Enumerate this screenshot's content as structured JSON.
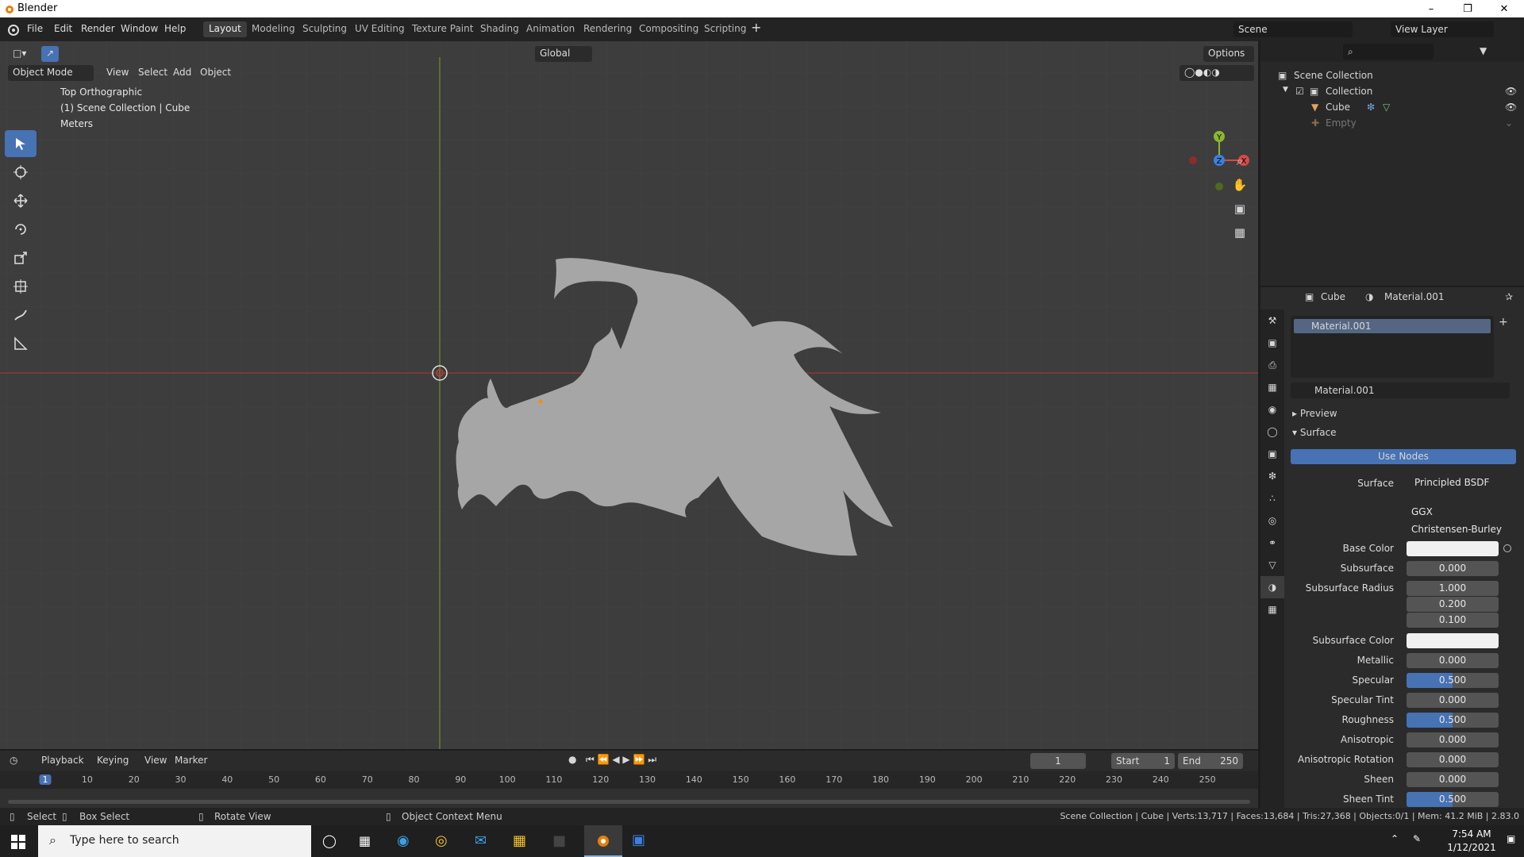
{
  "app": {
    "title": "Blender"
  },
  "menus": [
    "File",
    "Edit",
    "Render",
    "Window",
    "Help"
  ],
  "workspaces": [
    "Layout",
    "Modeling",
    "Sculpting",
    "UV Editing",
    "Texture Paint",
    "Shading",
    "Animation",
    "Rendering",
    "Compositing",
    "Scripting"
  ],
  "active_workspace": "Layout",
  "scene": {
    "name": "Scene",
    "view_layer": "View Layer"
  },
  "viewport": {
    "orientation": "Global",
    "options": "Options",
    "mode": "Object Mode",
    "header_menus": [
      "View",
      "Select",
      "Add",
      "Object"
    ],
    "overlay_lines": [
      "Top Orthographic",
      "(1) Scene Collection | Cube",
      "Meters"
    ],
    "gizmo": {
      "y": "Y",
      "x": "X",
      "z": "Z"
    }
  },
  "outliner": {
    "root": "Scene Collection",
    "collection": "Collection",
    "objects": [
      "Cube",
      "Empty"
    ]
  },
  "properties": {
    "object": "Cube",
    "material": "Material.001",
    "slot": "Material.001",
    "panels": {
      "preview": "Preview",
      "surface": "Surface"
    },
    "use_nodes": "Use Nodes",
    "surface_label": "Surface",
    "surface_value": "Principled BSDF",
    "distribution": "GGX",
    "subsurface_method": "Christensen-Burley",
    "base_color_label": "Base Color",
    "base_color": "#f0f0f0",
    "subsurface_color_label": "Subsurface Color",
    "subsurface_color": "#f0f0f0",
    "subsurface_radius_label": "Subsurface Radius",
    "subsurface_radius": [
      "1.000",
      "0.200",
      "0.100"
    ],
    "fields": [
      {
        "label": "Subsurface",
        "value": "0.000"
      },
      {
        "label": "Metallic",
        "value": "0.000"
      },
      {
        "label": "Specular",
        "value": "0.500"
      },
      {
        "label": "Specular Tint",
        "value": "0.000"
      },
      {
        "label": "Roughness",
        "value": "0.500"
      },
      {
        "label": "Anisotropic",
        "value": "0.000"
      },
      {
        "label": "Anisotropic Rotation",
        "value": "0.000"
      },
      {
        "label": "Sheen",
        "value": "0.000"
      },
      {
        "label": "Sheen Tint",
        "value": "0.500"
      }
    ]
  },
  "timeline": {
    "menus": [
      "Playback",
      "Keying",
      "View",
      "Marker"
    ],
    "current_frame": "1",
    "start_label": "Start",
    "start": "1",
    "end_label": "End",
    "end": "250",
    "ruler": [
      "1",
      "10",
      "20",
      "30",
      "40",
      "50",
      "60",
      "70",
      "80",
      "90",
      "100",
      "110",
      "120",
      "130",
      "140",
      "150",
      "160",
      "170",
      "180",
      "190",
      "200",
      "210",
      "220",
      "230",
      "240",
      "250"
    ]
  },
  "status": {
    "select": "Select",
    "box_select": "Box Select",
    "rotate": "Rotate View",
    "context": "Object Context Menu",
    "stats": "Scene Collection | Cube | Verts:13,717 | Faces:13,684 | Tris:27,368 | Objects:0/1 | Mem: 41.2 MiB | 2.83.0"
  },
  "taskbar": {
    "search": "Type here to search",
    "time": "7:54 AM",
    "date": "1/12/2021"
  },
  "colors": {
    "accent": "#4772b3",
    "x_axis": "#d64a4a",
    "y_axis": "#8ab833",
    "z_axis": "#3d7fe0"
  }
}
